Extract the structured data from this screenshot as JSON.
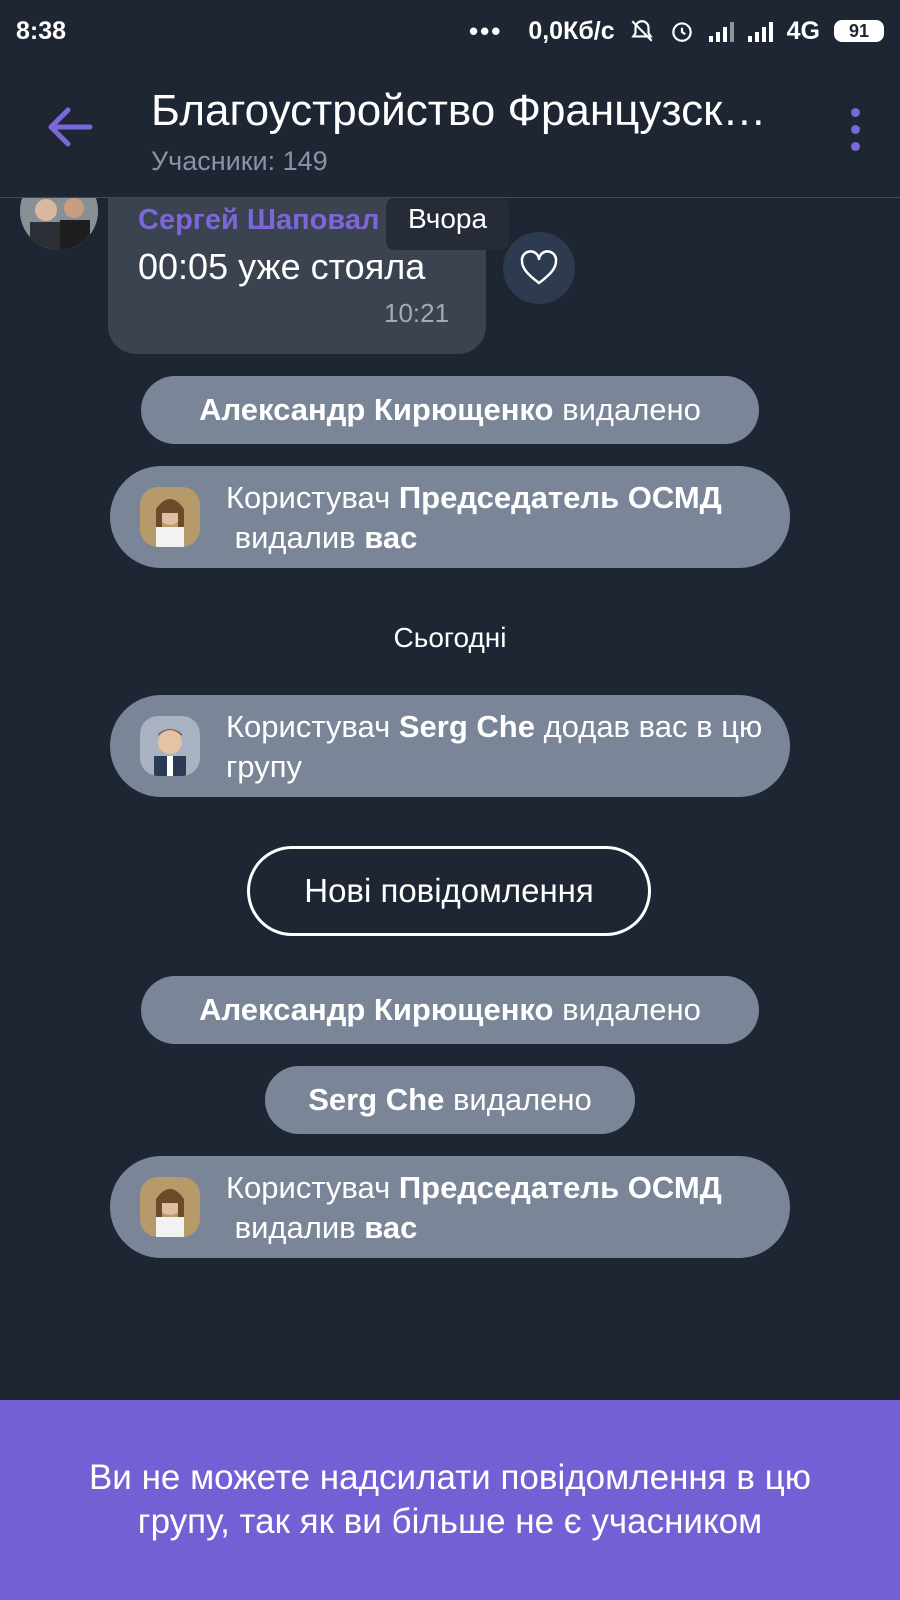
{
  "status": {
    "time": "8:38",
    "dots": "•••",
    "net_speed": "0,0Кб/с",
    "network": "4G",
    "battery": "91"
  },
  "header": {
    "title": "Благоустройство Французск…",
    "subtitle": "Учасники: 149"
  },
  "message": {
    "sender": "Сергей Шаповал",
    "text": "00:05 уже стояла",
    "time": "10:21",
    "date_chip": "Вчора"
  },
  "events": {
    "e1": {
      "name": "Александр Кирющенко",
      "suffix": " видалено"
    },
    "n1": {
      "prefix": "Користувач ",
      "name": "Председатель ОСМД",
      "mid": " видалив ",
      "obj": "вас"
    },
    "today": "Сьогодні",
    "n2": {
      "prefix": "Користувач ",
      "name": "Serg Che",
      "rest": " додав вас в цю групу"
    },
    "new_messages": "Нові повідомлення",
    "e2": {
      "name": "Александр Кирющенко",
      "suffix": " видалено"
    },
    "e3": {
      "name": "Serg Che",
      "suffix": " видалено"
    },
    "n3": {
      "prefix": "Користувач ",
      "name": "Председатель ОСМД",
      "mid": " видалив ",
      "obj": "вас"
    }
  },
  "bottom_notice": "Ви не можете надсилати повідомлення в цю групу, так як ви більше не є учасником",
  "colors": {
    "background": "#1f2633",
    "accent": "#7b67d9",
    "pill": "#7a8698",
    "bottom_bar": "#7360d4"
  },
  "icons": [
    "back-arrow-icon",
    "more-vert-icon",
    "heart-icon",
    "mute-icon",
    "alarm-icon",
    "signal-icon",
    "battery-icon"
  ]
}
